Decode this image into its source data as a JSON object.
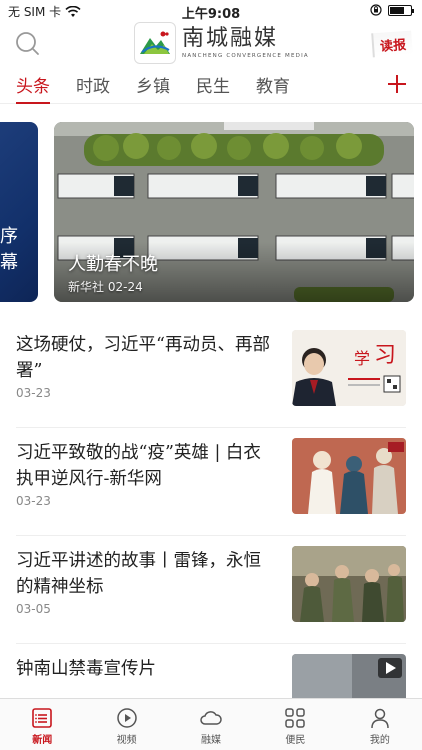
{
  "status_bar": {
    "carrier": "无 SIM 卡",
    "time": "上午9:08"
  },
  "header": {
    "logo_cn": "南城融媒",
    "logo_en": "NANCHENG CONVERGENCE MEDIA",
    "read_paper": "读报"
  },
  "tabs": [
    {
      "label": "头条"
    },
    {
      "label": "时政"
    },
    {
      "label": "乡镇"
    },
    {
      "label": "民生"
    },
    {
      "label": "教育"
    }
  ],
  "carousel": {
    "prev_text": "序幕",
    "caption": "人勤春不晚",
    "source": "新华社",
    "date": "02-24"
  },
  "news": [
    {
      "title": "这场硬仗，习近平“再动员、再部署”",
      "date": "03-23"
    },
    {
      "title": "习近平致敬的战“疫”英雄 | 白衣执甲逆风行-新华网",
      "date": "03-23"
    },
    {
      "title": "习近平讲述的故事丨雷锋，永恒的精神坐标",
      "date": "03-05"
    },
    {
      "title": "钟南山禁毒宣传片",
      "date": ""
    }
  ],
  "bottom_nav": [
    {
      "label": "新闻",
      "icon": "news-icon"
    },
    {
      "label": "视频",
      "icon": "video-icon"
    },
    {
      "label": "融媒",
      "icon": "cloud-icon"
    },
    {
      "label": "便民",
      "icon": "grid-icon"
    },
    {
      "label": "我的",
      "icon": "user-icon"
    }
  ],
  "colors": {
    "accent": "#c8161d"
  }
}
